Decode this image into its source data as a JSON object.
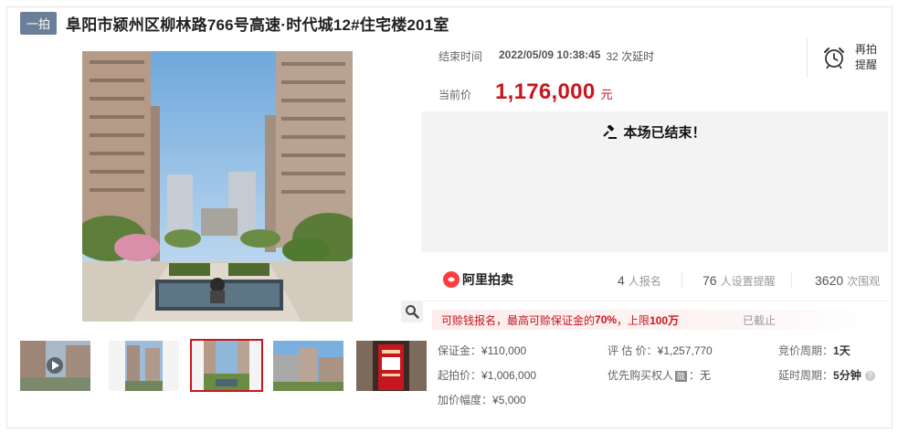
{
  "header": {
    "tag": "一拍",
    "title": "阜阳市颍州区柳林路766号高速·时代城12#住宅楼201室"
  },
  "auction": {
    "end_time_label": "结束时间",
    "end_time": "2022/05/09 10:38:45",
    "extensions": "32 次延时",
    "price_label": "当前价",
    "price": "1,176,000",
    "price_unit": "元",
    "remind_line1": "再拍",
    "remind_line2": "提醒",
    "ended_text": "本场已结束！"
  },
  "stats": {
    "brand": "阿里拍卖",
    "signup_count": "4",
    "signup_label": "人报名",
    "reminder_count": "76",
    "reminder_label": "人设置提醒",
    "view_count": "3620",
    "view_label": "次围观"
  },
  "notice": {
    "text_a": "可赊钱报名，最高可赊保证金的",
    "pct": "70%",
    "text_b": "，上限",
    "limit": "100万",
    "status": "已截止"
  },
  "info": {
    "deposit_label": "保证金：",
    "deposit": "¥110,000",
    "appraisal_label": "评 估 价：",
    "appraisal": "¥1,257,770",
    "bid_period_label": "竞价周期：",
    "bid_period": "1天",
    "start_price_label": "起拍价：",
    "start_price": "¥1,006,000",
    "priority_label": "优先购买权人",
    "priority_mark": "陇",
    "priority_value": "：无",
    "delay_label": "延时周期：",
    "delay": "5分钟",
    "increment_label": "加价幅度：",
    "increment": "¥5,000"
  }
}
